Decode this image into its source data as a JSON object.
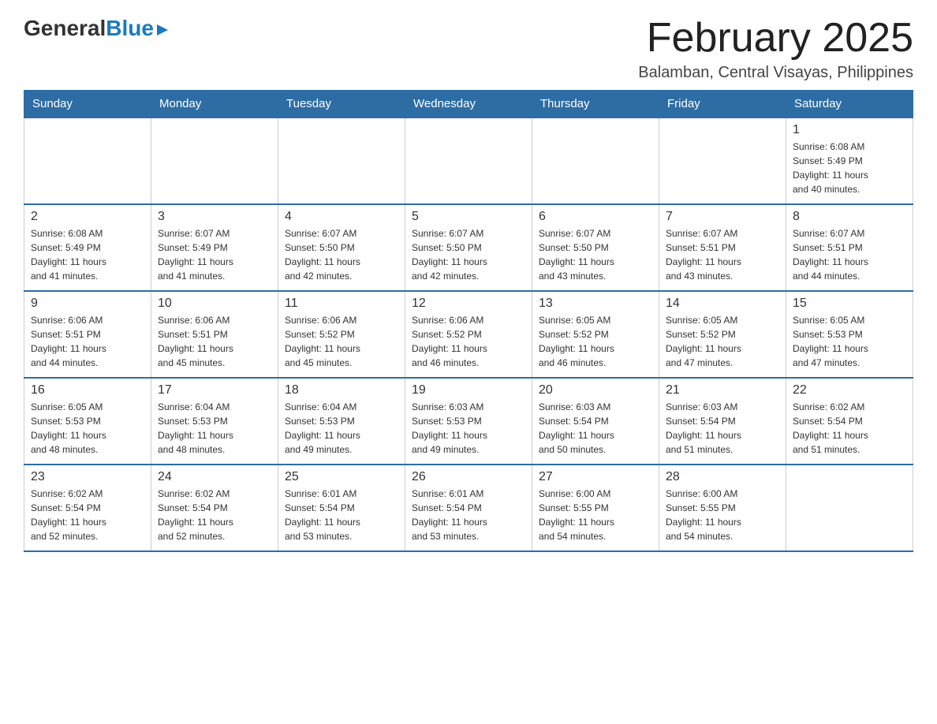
{
  "logo": {
    "general": "General",
    "blue": "Blue"
  },
  "header": {
    "month_title": "February 2025",
    "subtitle": "Balamban, Central Visayas, Philippines"
  },
  "days_of_week": [
    "Sunday",
    "Monday",
    "Tuesday",
    "Wednesday",
    "Thursday",
    "Friday",
    "Saturday"
  ],
  "weeks": [
    {
      "days": [
        {
          "number": "",
          "info": ""
        },
        {
          "number": "",
          "info": ""
        },
        {
          "number": "",
          "info": ""
        },
        {
          "number": "",
          "info": ""
        },
        {
          "number": "",
          "info": ""
        },
        {
          "number": "",
          "info": ""
        },
        {
          "number": "1",
          "info": "Sunrise: 6:08 AM\nSunset: 5:49 PM\nDaylight: 11 hours\nand 40 minutes."
        }
      ]
    },
    {
      "days": [
        {
          "number": "2",
          "info": "Sunrise: 6:08 AM\nSunset: 5:49 PM\nDaylight: 11 hours\nand 41 minutes."
        },
        {
          "number": "3",
          "info": "Sunrise: 6:07 AM\nSunset: 5:49 PM\nDaylight: 11 hours\nand 41 minutes."
        },
        {
          "number": "4",
          "info": "Sunrise: 6:07 AM\nSunset: 5:50 PM\nDaylight: 11 hours\nand 42 minutes."
        },
        {
          "number": "5",
          "info": "Sunrise: 6:07 AM\nSunset: 5:50 PM\nDaylight: 11 hours\nand 42 minutes."
        },
        {
          "number": "6",
          "info": "Sunrise: 6:07 AM\nSunset: 5:50 PM\nDaylight: 11 hours\nand 43 minutes."
        },
        {
          "number": "7",
          "info": "Sunrise: 6:07 AM\nSunset: 5:51 PM\nDaylight: 11 hours\nand 43 minutes."
        },
        {
          "number": "8",
          "info": "Sunrise: 6:07 AM\nSunset: 5:51 PM\nDaylight: 11 hours\nand 44 minutes."
        }
      ]
    },
    {
      "days": [
        {
          "number": "9",
          "info": "Sunrise: 6:06 AM\nSunset: 5:51 PM\nDaylight: 11 hours\nand 44 minutes."
        },
        {
          "number": "10",
          "info": "Sunrise: 6:06 AM\nSunset: 5:51 PM\nDaylight: 11 hours\nand 45 minutes."
        },
        {
          "number": "11",
          "info": "Sunrise: 6:06 AM\nSunset: 5:52 PM\nDaylight: 11 hours\nand 45 minutes."
        },
        {
          "number": "12",
          "info": "Sunrise: 6:06 AM\nSunset: 5:52 PM\nDaylight: 11 hours\nand 46 minutes."
        },
        {
          "number": "13",
          "info": "Sunrise: 6:05 AM\nSunset: 5:52 PM\nDaylight: 11 hours\nand 46 minutes."
        },
        {
          "number": "14",
          "info": "Sunrise: 6:05 AM\nSunset: 5:52 PM\nDaylight: 11 hours\nand 47 minutes."
        },
        {
          "number": "15",
          "info": "Sunrise: 6:05 AM\nSunset: 5:53 PM\nDaylight: 11 hours\nand 47 minutes."
        }
      ]
    },
    {
      "days": [
        {
          "number": "16",
          "info": "Sunrise: 6:05 AM\nSunset: 5:53 PM\nDaylight: 11 hours\nand 48 minutes."
        },
        {
          "number": "17",
          "info": "Sunrise: 6:04 AM\nSunset: 5:53 PM\nDaylight: 11 hours\nand 48 minutes."
        },
        {
          "number": "18",
          "info": "Sunrise: 6:04 AM\nSunset: 5:53 PM\nDaylight: 11 hours\nand 49 minutes."
        },
        {
          "number": "19",
          "info": "Sunrise: 6:03 AM\nSunset: 5:53 PM\nDaylight: 11 hours\nand 49 minutes."
        },
        {
          "number": "20",
          "info": "Sunrise: 6:03 AM\nSunset: 5:54 PM\nDaylight: 11 hours\nand 50 minutes."
        },
        {
          "number": "21",
          "info": "Sunrise: 6:03 AM\nSunset: 5:54 PM\nDaylight: 11 hours\nand 51 minutes."
        },
        {
          "number": "22",
          "info": "Sunrise: 6:02 AM\nSunset: 5:54 PM\nDaylight: 11 hours\nand 51 minutes."
        }
      ]
    },
    {
      "days": [
        {
          "number": "23",
          "info": "Sunrise: 6:02 AM\nSunset: 5:54 PM\nDaylight: 11 hours\nand 52 minutes."
        },
        {
          "number": "24",
          "info": "Sunrise: 6:02 AM\nSunset: 5:54 PM\nDaylight: 11 hours\nand 52 minutes."
        },
        {
          "number": "25",
          "info": "Sunrise: 6:01 AM\nSunset: 5:54 PM\nDaylight: 11 hours\nand 53 minutes."
        },
        {
          "number": "26",
          "info": "Sunrise: 6:01 AM\nSunset: 5:54 PM\nDaylight: 11 hours\nand 53 minutes."
        },
        {
          "number": "27",
          "info": "Sunrise: 6:00 AM\nSunset: 5:55 PM\nDaylight: 11 hours\nand 54 minutes."
        },
        {
          "number": "28",
          "info": "Sunrise: 6:00 AM\nSunset: 5:55 PM\nDaylight: 11 hours\nand 54 minutes."
        },
        {
          "number": "",
          "info": ""
        }
      ]
    }
  ]
}
